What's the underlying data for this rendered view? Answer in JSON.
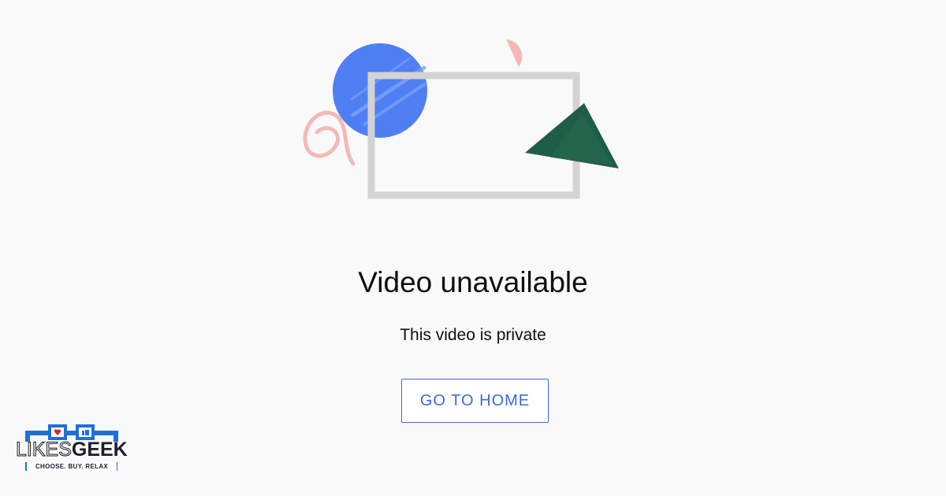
{
  "error": {
    "title": "Video unavailable",
    "message": "This video is private",
    "button_label": "GO TO HOME"
  },
  "watermark": {
    "brand_light": "LIKES",
    "brand_bold": "GEEK",
    "tagline": "CHOOSE. BUY. RELAX"
  },
  "colors": {
    "background": "#f9f9f9",
    "accent": "#3e6ad1",
    "circle": "#4f7ff2",
    "triangle": "#1e5d46",
    "pink": "#f4b9b6",
    "frame": "#d3d3d3",
    "logo_blue": "#1e6fd9"
  },
  "icons": {
    "illustration": "broken-video-illustration",
    "logo": "likesgeek-logo"
  }
}
